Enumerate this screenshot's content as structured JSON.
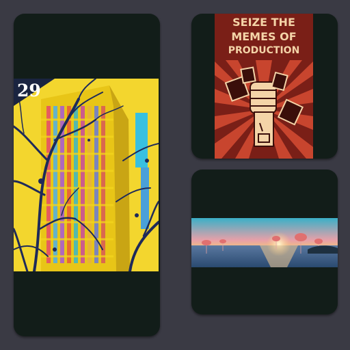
{
  "cards": [
    {
      "id": "left",
      "badge": "29",
      "artwork": "colorful-building-with-tree-branches"
    },
    {
      "id": "top-right",
      "poster_lines": [
        "SEIZE THE",
        "MEMES OF",
        "PRODUCTION"
      ],
      "artwork": "raised-fist-propaganda-poster"
    },
    {
      "id": "bottom-right",
      "artwork": "sunset-sea-panorama-with-jellyfish"
    }
  ],
  "colors": {
    "background": "#3a3a44",
    "card": "#121d19",
    "poster_red": "#7a1f17",
    "poster_cream": "#f4d4a8",
    "building_yellow": "#f2d21a"
  }
}
